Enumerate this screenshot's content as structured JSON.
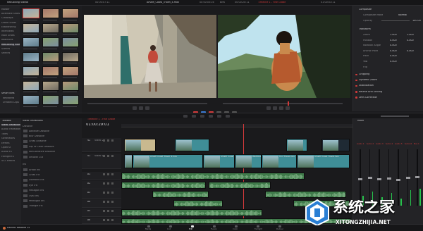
{
  "top_bar": {
    "media_pool_label": "Rebuilding Videos",
    "left_timecode": "00:00:07:11",
    "clip_name": "Amalfi_Coast_Travel_4.mov",
    "source_tc": "00:00:05:16",
    "bar_label": "BMS",
    "record_tc": "00:00:20:11",
    "timeline_name": "Timeline 1 - Fine Grade",
    "right_tc": "01:00:03:11"
  },
  "bins": [
    "Master",
    "Alternate Shots",
    "Cutaways",
    "Drone Shots",
    "Establishing",
    "Interviews",
    "Main Shots",
    "Reactions",
    "Rebuilding Videos",
    "Scenes",
    "Selects"
  ],
  "smart_bins_label": "Smart Bins",
  "smart_bins": [
    "Keywords",
    "Unrated Clips"
  ],
  "toolbox": {
    "header": "Toolbox",
    "items": [
      "Video Transitions",
      "Audio Transitions",
      "Titles",
      "Generators",
      "Effects",
      "OpenFX",
      "Audio FX",
      "FairlightFX",
      "VST Effects"
    ],
    "section_dissolve": "Dissolve",
    "dissolve_items": [
      "Additive Dissolve",
      "Blur Dissolve",
      "Cross Dissolve",
      "Dip To Color Dissolve",
      "Non-Additive Dissolve",
      "Smooth Cut"
    ],
    "section_iris": "Iris",
    "iris_items": [
      "Arrow Iris",
      "Cross Iris",
      "Diamond Iris",
      "Eye Iris",
      "Hexagon Iris",
      "Oval Iris",
      "Pentagon Iris",
      "Triangle Iris"
    ]
  },
  "inspector": {
    "composite_header": "Composite",
    "composite_mode_label": "Composite Mode",
    "composite_mode_value": "Normal",
    "opacity_label": "Opacity",
    "opacity_value": "100.00",
    "transform_header": "Transform",
    "rows": [
      {
        "label": "Zoom",
        "x": "1.000",
        "y": "1.000"
      },
      {
        "label": "Position",
        "x": "0.000",
        "y": "0.000"
      },
      {
        "label": "Rotation Angle",
        "x": "0.000",
        "y": ""
      },
      {
        "label": "Anchor Point",
        "x": "0.000",
        "y": "0.000"
      },
      {
        "label": "Pitch",
        "x": "0.000",
        "y": ""
      },
      {
        "label": "Yaw",
        "x": "0.000",
        "y": ""
      },
      {
        "label": "Flip",
        "x": "",
        "y": ""
      }
    ],
    "sections": [
      "Cropping",
      "Dynamic Zoom",
      "Stabilization",
      "Retime And Scaling",
      "Lens Correction"
    ]
  },
  "timeline": {
    "tab_name": "Timeline 1 - Fine Grade",
    "timecode": "01:00:29:01",
    "tracks": [
      {
        "id": "V2",
        "name": "Video 2"
      },
      {
        "id": "V1",
        "name": "Video 1"
      },
      {
        "id": "A1",
        "name": ""
      },
      {
        "id": "A2",
        "name": ""
      },
      {
        "id": "A3",
        "name": ""
      },
      {
        "id": "A4",
        "name": ""
      },
      {
        "id": "A5",
        "name": ""
      },
      {
        "id": "A6",
        "name": ""
      }
    ],
    "clip_labels": [
      "Amalfi_Coast_Travel_4.mov",
      "Amalfi_Coast_Travel_2.mov",
      "Wedding Pizza.mov",
      "Tour Travel.mov",
      "Amalfi_Coast_Travel.mov"
    ]
  },
  "mixer": {
    "header": "Mixer",
    "channels": [
      "Audio 1",
      "Audio 2",
      "Audio 3",
      "Audio 4",
      "Audio 5",
      "Audio 6",
      "Bus 1"
    ]
  },
  "pages": [
    "Media",
    "Cut",
    "Edit",
    "Fusion",
    "Color",
    "Fairlight",
    "Deliver"
  ],
  "bottom_app": "DaVinci Resolve 15",
  "watermark": {
    "main": "系统之家",
    "sub": "XITONGZHIJIA.NET"
  },
  "colors": {
    "accent_red": "#d23a3a",
    "clip_teal": "#3f8e97",
    "audio_green": "#3f7a4a",
    "meter_green": "#27c24c"
  }
}
